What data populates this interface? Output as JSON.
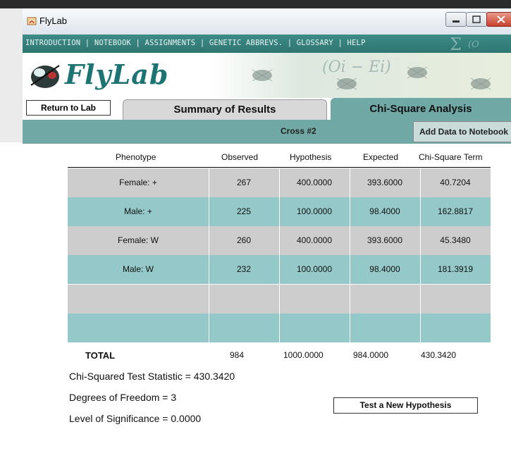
{
  "window": {
    "title": "FlyLab"
  },
  "nav": {
    "text": "INTRODUCTION | NOTEBOOK | ASSIGNMENTS | GENETIC ABBREVS. | GLOSSARY | HELP"
  },
  "header": {
    "logo": "FlyLab",
    "formula": "(Oi − Ei)"
  },
  "tabs": {
    "return_label": "Return to Lab",
    "summary_label": "Summary of Results",
    "chi_label": "Chi-Square Analysis"
  },
  "crossbar": {
    "cross_label": "Cross #2",
    "add_label": "Add Data to Notebook"
  },
  "table": {
    "headers": [
      "Phenotype",
      "Observed",
      "Hypothesis",
      "Expected",
      "Chi-Square Term"
    ],
    "rows": [
      [
        "Female: +",
        "267",
        "400.0000",
        "393.6000",
        "40.7204"
      ],
      [
        "Male: +",
        "225",
        "100.0000",
        "98.4000",
        "162.8817"
      ],
      [
        "Female: W",
        "260",
        "400.0000",
        "393.6000",
        "45.3480"
      ],
      [
        "Male: W",
        "232",
        "100.0000",
        "98.4000",
        "181.3919"
      ],
      [
        "",
        "",
        "",
        "",
        ""
      ],
      [
        "",
        "",
        "",
        "",
        ""
      ]
    ],
    "total": [
      "TOTAL",
      "984",
      "1000.0000",
      "984.0000",
      "430.3420"
    ]
  },
  "stats": {
    "chi_squared": "Chi-Squared Test Statistic = 430.3420",
    "dof": "Degrees of Freedom = 3",
    "significance": "Level of Significance = 0.0000"
  },
  "actions": {
    "new_hypothesis": "Test a New Hypothesis"
  },
  "colors": {
    "teal": "#6fa8a4",
    "row_teal": "#95c8c8",
    "row_gray": "#cdcdcd",
    "nav": "#2f7572"
  }
}
